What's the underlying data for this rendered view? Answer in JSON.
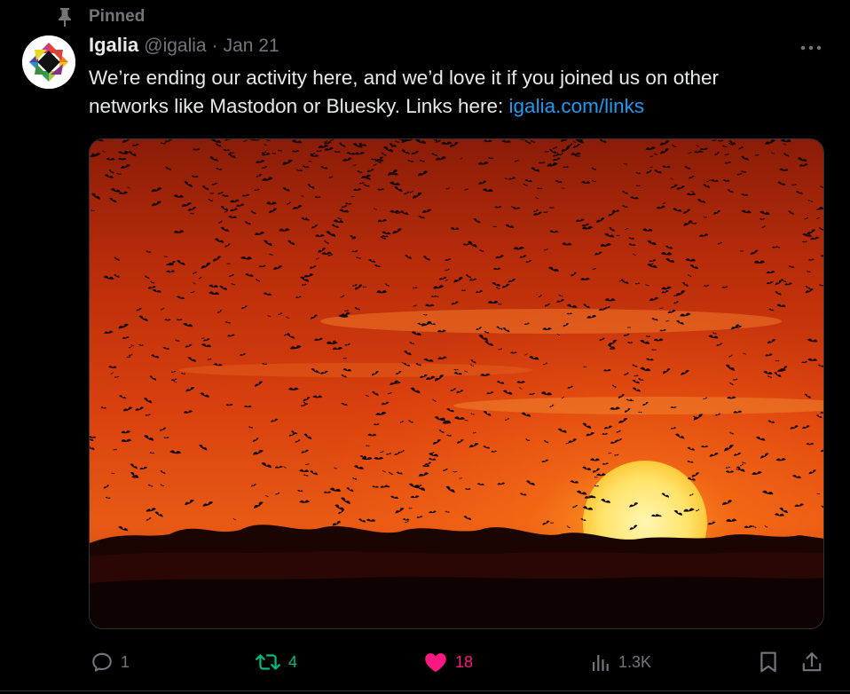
{
  "pinned": {
    "label": "Pinned",
    "icon": "pin-icon"
  },
  "author": {
    "display_name": "Igalia",
    "handle": "@igalia",
    "separator": "·",
    "date": "Jan 21",
    "avatar_icon": "igalia-logo-avatar"
  },
  "more_icon": "more-dots-icon",
  "tweet": {
    "text_before_link": "We’re ending our activity here, and we’d love it if you joined us on other networks like Mastodon or Bluesky. Links here: ",
    "link_text": "igalia.com/links"
  },
  "media": {
    "description_icon": "photo"
  },
  "actions": {
    "reply_count": "1",
    "retweet_count": "4",
    "like_count": "18",
    "views_count": "1.3K"
  },
  "colors": {
    "background": "#000000",
    "text": "#e7e9ea",
    "muted": "#71767b",
    "link": "#1d9bf0",
    "retweet": "#00ba7c",
    "like": "#f91880"
  }
}
